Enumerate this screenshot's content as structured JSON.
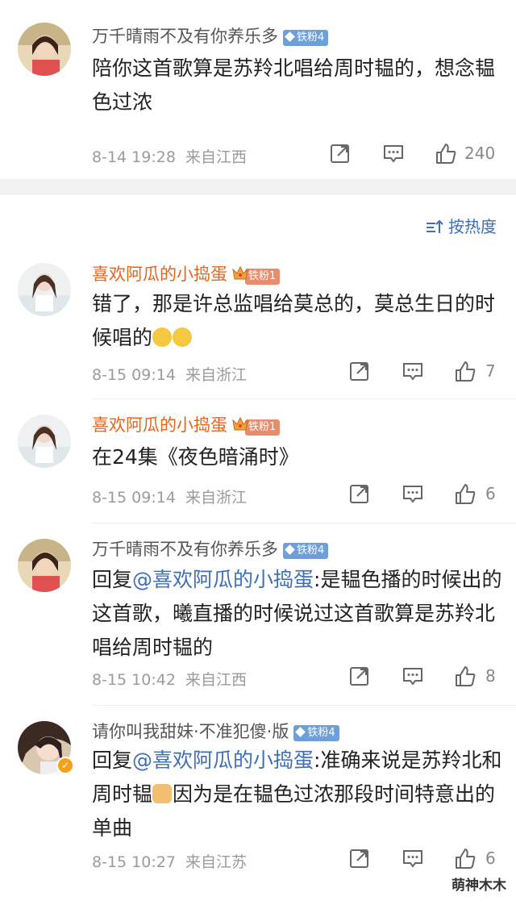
{
  "sort_label": "按热度",
  "watermark": "萌神木木",
  "comments": [
    {
      "user": "万千晴雨不及有你养乐多",
      "badge": "铁粉4",
      "text": "陪你这首歌算是苏羚北唱给周时韫的，想念韫色过浓",
      "time": "8-14 19:28",
      "location": "来自江西",
      "likes": "240"
    },
    {
      "user": "喜欢阿瓜的小捣蛋",
      "badge": "铁粉1",
      "text": "错了，那是许总监唱给莫总的，莫总生日的时候唱的",
      "time": "8-15 09:14",
      "location": "来自浙江",
      "likes": "7"
    },
    {
      "user": "喜欢阿瓜的小捣蛋",
      "badge": "铁粉1",
      "text": "在24集《夜色暗涌时》",
      "time": "8-15 09:14",
      "location": "来自浙江",
      "likes": "6"
    },
    {
      "user": "万千晴雨不及有你养乐多",
      "badge": "铁粉4",
      "reply_prefix": "回复",
      "mention": "@喜欢阿瓜的小捣蛋",
      "text": ":是韫色播的时候出的这首歌，曦直播的时候说过这首歌算是苏羚北唱给周时韫的",
      "time": "8-15 10:42",
      "location": "来自江西",
      "likes": "8"
    },
    {
      "user": "请你叫我甜妹·不准犯傻·版",
      "badge": "铁粉4",
      "reply_prefix": "回复",
      "mention": "@喜欢阿瓜的小捣蛋",
      "text_a": ":准确来说是苏羚北和周时韫",
      "text_b": "因为是在韫色过浓那段时间特意出的单曲",
      "time": "8-15 10:27",
      "location": "来自江苏",
      "likes": "6"
    }
  ],
  "colors": {
    "link": "#3d6fb8",
    "orange_name": "#e8641b",
    "meta": "#9b9b9b",
    "fan_badge_blue": "#6f9fd8",
    "fan_badge_orange": "#e98c6c"
  },
  "icons": [
    "share-icon",
    "comment-icon",
    "like-icon",
    "sort-icon",
    "verified-icon",
    "crown-icon"
  ]
}
